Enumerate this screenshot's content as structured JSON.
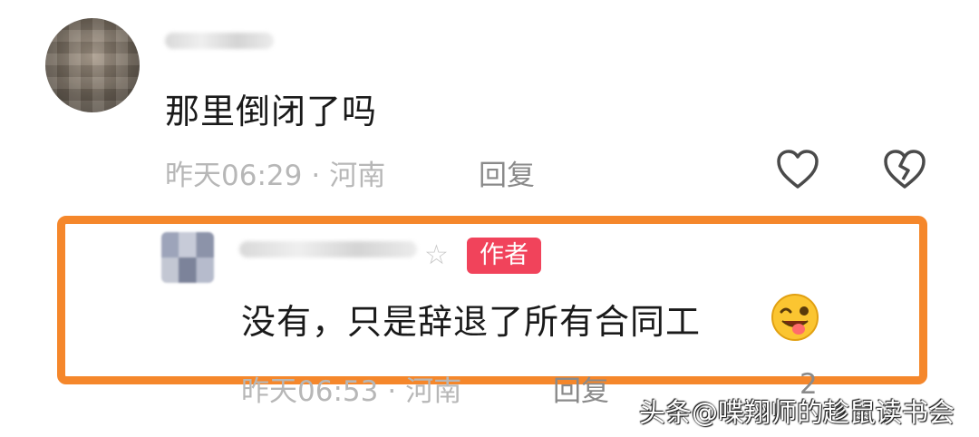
{
  "comment1": {
    "avatar_icon": "blurred-avatar-icon",
    "text": "那里倒闭了吗",
    "time": "昨天06:29",
    "separator": "·",
    "location": "河南",
    "reply_label": "回复"
  },
  "comment2": {
    "author_badge": "作者",
    "star": "☆",
    "text": "没有，只是辞退了所有合同工",
    "emoji": "wink-tongue-emoji",
    "time": "昨天06:53",
    "separator": "·",
    "location": "河南",
    "reply_label": "回复",
    "like_count": "2"
  },
  "watermark": "头条@喋翔师的趁鼠读书会",
  "colors": {
    "highlight": "#f5872b",
    "badge": "#f1435b",
    "meta": "#b7b7b7"
  }
}
